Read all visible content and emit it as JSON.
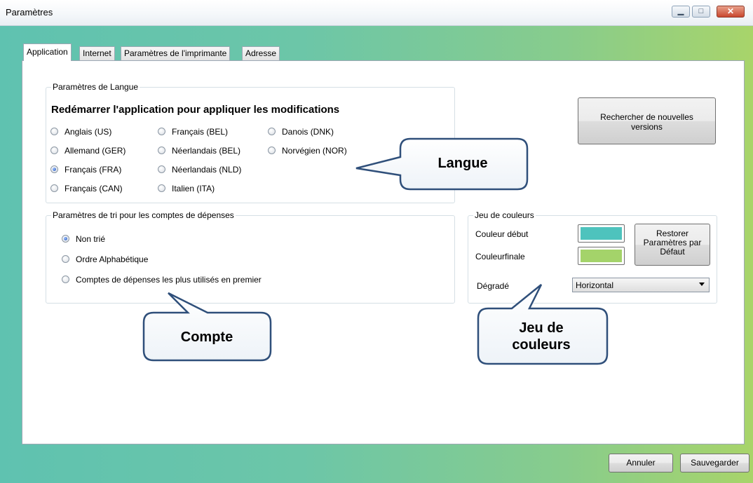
{
  "window": {
    "title": "Paramètres",
    "icons": {
      "minimize": "minimize-icon",
      "maximize": "maximize-icon",
      "close": "close-icon"
    }
  },
  "tabs": [
    "Application",
    "Internet",
    "Paramètres de l'imprimante",
    "Adresse"
  ],
  "langue": {
    "group_label": "Paramètres de Langue",
    "notice": "Redémarrer l'application pour appliquer les modifications",
    "options": [
      "Anglais (US)",
      "Allemand (GER)",
      "Français (FRA)",
      "Français (CAN)",
      "Français (BEL)",
      "Néerlandais (BEL)",
      "Néerlandais (NLD)",
      "Italien (ITA)",
      "Danois (DNK)",
      "Norvégien (NOR)"
    ],
    "selected": "Français (FRA)"
  },
  "update_button": "Rechercher de nouvelles versions",
  "tri": {
    "group_label": "Paramètres de tri pour les comptes de dépenses",
    "options": [
      "Non trié",
      "Ordre Alphabétique",
      "Comptes de dépenses les plus utilisés en premier"
    ],
    "selected": "Non trié"
  },
  "couleurs": {
    "group_label": "Jeu de couleurs",
    "start_label": "Couleur début",
    "end_label": "Couleurfinale",
    "start_color": "#4ec3bd",
    "end_color": "#a4d36a",
    "restore_button": "Restorer Paramètres par Défaut",
    "gradient_label": "Dégradé",
    "gradient_value": "Horizontal"
  },
  "callouts": {
    "langue": "Langue",
    "compte": "Compte",
    "couleurs": "Jeu de couleurs"
  },
  "footer": {
    "cancel": "Annuler",
    "save": "Sauvegarder"
  }
}
